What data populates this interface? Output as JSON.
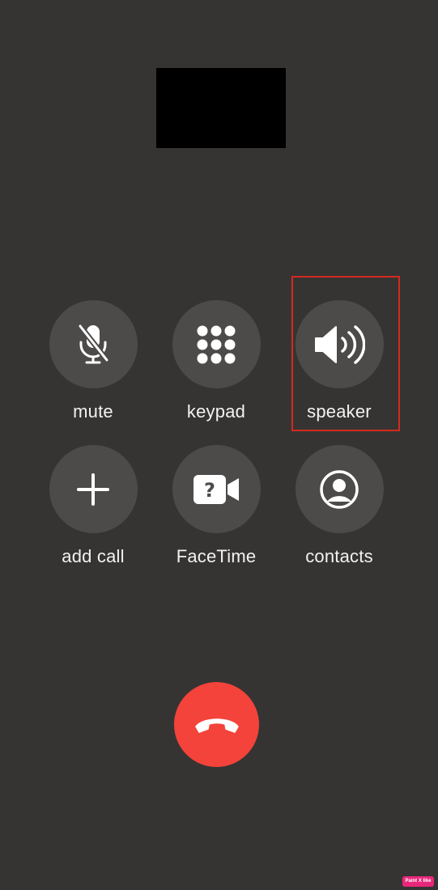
{
  "controls": {
    "mute": {
      "label": "mute",
      "icon": "mic-slash-icon"
    },
    "keypad": {
      "label": "keypad",
      "icon": "keypad-grid-icon"
    },
    "speaker": {
      "label": "speaker",
      "icon": "speaker-wave-icon",
      "highlighted": true
    },
    "add_call": {
      "label": "add call",
      "icon": "plus-icon"
    },
    "facetime": {
      "label": "FaceTime",
      "icon": "video-question-icon"
    },
    "contacts": {
      "label": "contacts",
      "icon": "person-circle-icon"
    }
  },
  "end_call": {
    "icon": "phone-hangup-icon",
    "color": "#f4433a"
  },
  "colors": {
    "background": "#363433",
    "button": "#4d4b49",
    "highlight": "#d42a1f"
  },
  "watermark": {
    "text": "Paint X like"
  }
}
